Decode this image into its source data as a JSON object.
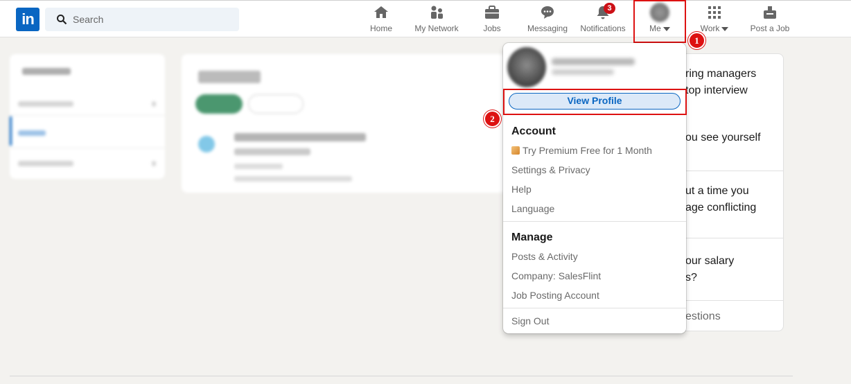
{
  "search": {
    "placeholder": "Search"
  },
  "nav": {
    "home": "Home",
    "network": "My Network",
    "jobs": "Jobs",
    "messaging": "Messaging",
    "notifications": "Notifications",
    "notifications_count": "3",
    "me": "Me",
    "work": "Work",
    "post_job": "Post a Job"
  },
  "steps": {
    "one": "1",
    "two": "2"
  },
  "right_card": {
    "line1": "ring managers",
    "line2": "top interview",
    "line3": "ou see yourself",
    "line4": "ut a time you",
    "line5": "age conflicting",
    "line6": "our salary",
    "line7": "s?",
    "line8": "estions"
  },
  "dropdown": {
    "view_profile": "View Profile",
    "account_heading": "Account",
    "premium": "Try Premium Free for 1 Month",
    "settings": "Settings & Privacy",
    "help": "Help",
    "language": "Language",
    "manage_heading": "Manage",
    "posts": "Posts & Activity",
    "company": "Company: SalesFlint",
    "job_posting": "Job Posting Account",
    "sign_out": "Sign Out"
  },
  "colors": {
    "brand": "#0a66c2",
    "highlight": "#dd1111",
    "badge": "#cc1016"
  },
  "icons": [
    "search-icon",
    "home-icon",
    "network-icon",
    "jobs-icon",
    "messaging-icon",
    "bell-icon",
    "grid-icon",
    "post-job-icon",
    "premium-icon",
    "chevron-down-icon"
  ]
}
